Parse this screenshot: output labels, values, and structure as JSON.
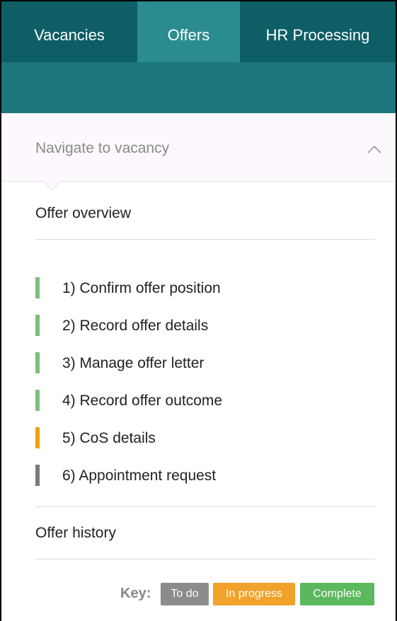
{
  "tabs": [
    {
      "label": "Vacancies"
    },
    {
      "label": "Offers"
    },
    {
      "label": "HR Processing"
    }
  ],
  "navigate": {
    "label": "Navigate to vacancy",
    "icon": "chevron-up-icon"
  },
  "sections": {
    "overview": "Offer overview",
    "history": "Offer history"
  },
  "steps": [
    {
      "label": "1) Confirm offer position",
      "status": "Complete"
    },
    {
      "label": "2) Record offer details",
      "status": "Complete"
    },
    {
      "label": "3) Manage offer letter",
      "status": "Complete"
    },
    {
      "label": "4) Record offer outcome",
      "status": "Complete"
    },
    {
      "label": "5) CoS details",
      "status": "In progress"
    },
    {
      "label": "6) Appointment request",
      "status": "To do"
    }
  ],
  "key": {
    "label": "Key:",
    "items": [
      {
        "label": "To do",
        "color": "#8c8c8c"
      },
      {
        "label": "In progress",
        "color": "#f0a22b"
      },
      {
        "label": "Complete",
        "color": "#5cb85c"
      }
    ]
  },
  "colors": {
    "nav_dark": "#0e5e66",
    "nav_active": "#2a8c91",
    "subbar": "#1c767b",
    "complete": "#7bbf7b",
    "in_progress": "#f0a000",
    "todo": "#7a7a7a"
  }
}
